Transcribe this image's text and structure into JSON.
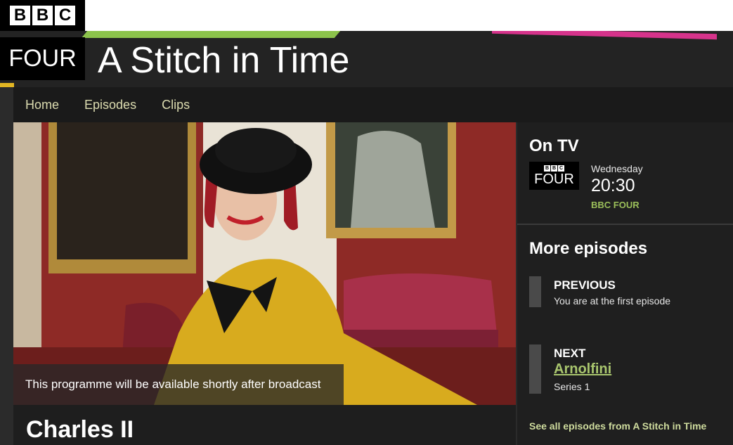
{
  "masthead": {
    "bbc_letters": [
      "B",
      "B",
      "C"
    ],
    "channel_logo": "FOUR",
    "show_title": "A Stitch in Time"
  },
  "nav": {
    "items": [
      {
        "label": "Home"
      },
      {
        "label": "Episodes"
      },
      {
        "label": "Clips"
      }
    ]
  },
  "hero": {
    "availability_notice": "This programme will be available shortly after broadcast",
    "episode_title": "Charles II"
  },
  "on_tv": {
    "heading": "On TV",
    "channel_logo_letters": [
      "B",
      "B",
      "C"
    ],
    "channel_logo_word": "FOUR",
    "day": "Wednesday",
    "time": "20:30",
    "channel": "BBC FOUR"
  },
  "more_episodes": {
    "heading": "More episodes",
    "previous": {
      "label": "PREVIOUS",
      "text": "You are at the first episode"
    },
    "next": {
      "label": "NEXT",
      "title": "Arnolfini",
      "series": "Series 1"
    },
    "see_all": "See all episodes from A Stitch in Time"
  },
  "colors": {
    "accent_green": "#9bbf5a",
    "link_green": "#a9c66e",
    "nav_text": "#dcdcb0",
    "background": "#2b2b2b"
  }
}
